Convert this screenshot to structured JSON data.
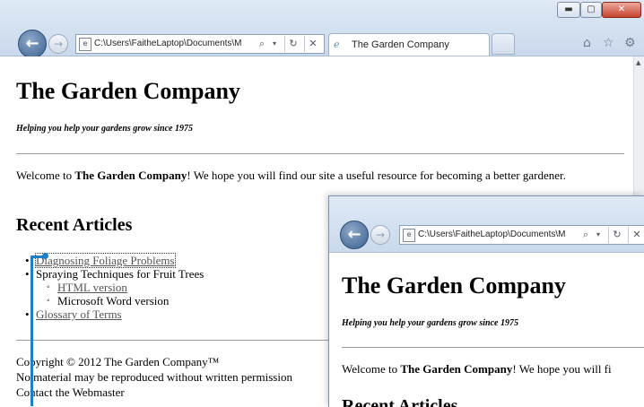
{
  "browser": {
    "address_url": "C:\\Users\\FaitheLaptop\\Documents\\M",
    "tab_title": "The Garden Company"
  },
  "page": {
    "site_title": "The Garden Company",
    "tagline": "Helping you help your gardens grow since 1975",
    "welcome_prefix": "Welcome to ",
    "welcome_company": "The Garden Company",
    "welcome_suffix": "! We hope you will find our site a useful resource for becoming a better gardener.",
    "recent_heading": "Recent Articles",
    "articles": [
      {
        "label": "Diagnosing Foliage Problems"
      },
      {
        "label": "Spraying Techniques for Fruit Trees"
      },
      {
        "label": "HTML version"
      },
      {
        "label": "Microsoft Word version"
      },
      {
        "label": "Glossary of Terms"
      }
    ],
    "footer": {
      "copyright": "Copyright © 2012 The Garden Company™",
      "notice": "No material may be reproduced without written permission",
      "contact": "Contact the Webmaster"
    }
  },
  "window2": {
    "address_url": "C:\\Users\\FaitheLaptop\\Documents\\M",
    "site_title": "The Garden Company",
    "tagline": "Helping you help your gardens grow since 1975",
    "welcome_prefix": "Welcome to ",
    "welcome_company": "The Garden Company",
    "welcome_suffix": "! We hope you will fi",
    "recent_heading": "Recent Articles"
  },
  "icons": {
    "back": "back-arrow-icon",
    "forward": "forward-arrow-icon",
    "page": "page-icon",
    "search": "search-icon",
    "refresh": "refresh-icon",
    "stop": "stop-icon",
    "home": "home-icon",
    "favorites": "star-icon",
    "tools": "gear-icon"
  },
  "colors": {
    "chrome_top": "#dfe9f5",
    "chrome_bottom": "#c9d9ec",
    "link": "#545454",
    "callout": "#1d7fc4"
  }
}
